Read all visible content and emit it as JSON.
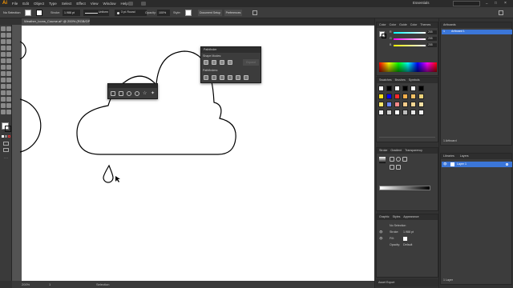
{
  "app": {
    "logo": "Ai",
    "workspace": "Essentials"
  },
  "menu": [
    "File",
    "Edit",
    "Object",
    "Type",
    "Select",
    "Effect",
    "View",
    "Window",
    "Help"
  ],
  "control_bar": {
    "selection_state": "No Selection",
    "stroke_label": "Stroke:",
    "stroke_value": "1.988 pt",
    "profile": "Uniform",
    "brush": "3 pt. Round",
    "opacity_label": "Opacity:",
    "opacity_value": "100%",
    "style_label": "Style:",
    "document_setup": "Document Setup",
    "preferences": "Preferences"
  },
  "document_tab": "Weather_Icons_Course.ai* @ 200% (RGB/GPU Preview)",
  "status": {
    "zoom": "200%",
    "page": "1",
    "mode": "Selection"
  },
  "pathfinder": {
    "title": "Pathfinder",
    "shape_modes_label": "Shape Modes:",
    "expand_label": "Expand",
    "pathfinders_label": "Pathfinders:"
  },
  "color_panel": {
    "tabs": [
      "Color",
      "Color Guide",
      "Color Themes"
    ],
    "channels": [
      {
        "name": "R",
        "value": "255"
      },
      {
        "name": "G",
        "value": "255"
      },
      {
        "name": "B",
        "value": "255"
      }
    ]
  },
  "swatches_panel": {
    "tabs": [
      "Swatches",
      "Brushes",
      "Symbols"
    ],
    "colors": [
      "#ffffff",
      "#000000",
      "#ffffff",
      "#000000",
      "#ffffff",
      "#000000",
      "#ffe11a",
      "#0000ff",
      "#ff2a2a",
      "#f6b04b",
      "#f4c165",
      "#eed47a",
      "#ffe76b",
      "#6b89ff",
      "#ff8a8a",
      "#f8cc8a",
      "#f7d794",
      "#f5e0a4",
      "#efefef",
      "#d0d0d0",
      "#ffffff",
      "#bdbdbd",
      "#e5e5e5",
      "#f0f0f0"
    ]
  },
  "gradient_panel": {
    "tabs": [
      "Stroke",
      "Gradient",
      "Transparency"
    ]
  },
  "appearance_panel": {
    "tabs": [
      "Graphic Styles",
      "Appearance"
    ],
    "title": "No Selection",
    "rows": [
      {
        "label": "Stroke:",
        "value": "1.988 pt"
      },
      {
        "label": "Fill:",
        "value": ""
      },
      {
        "label": "Opacity:",
        "value": "Default"
      }
    ],
    "asset_export": "Asset Export"
  },
  "artboards_panel": {
    "tabs": [
      "Artboards"
    ],
    "items": [
      {
        "number": "1",
        "name": "Artboard 1"
      }
    ],
    "footer": "1 Artboard"
  },
  "layers_panel": {
    "tabs": [
      "Libraries",
      "Layers"
    ],
    "items": [
      {
        "name": "Layer 1"
      }
    ],
    "footer": "1 Layer"
  },
  "colors": {
    "accent": "#ff9a00",
    "selection": "#3b76d8",
    "chrome_dark": "#2b2b2b",
    "chrome": "#3c3c3c"
  }
}
